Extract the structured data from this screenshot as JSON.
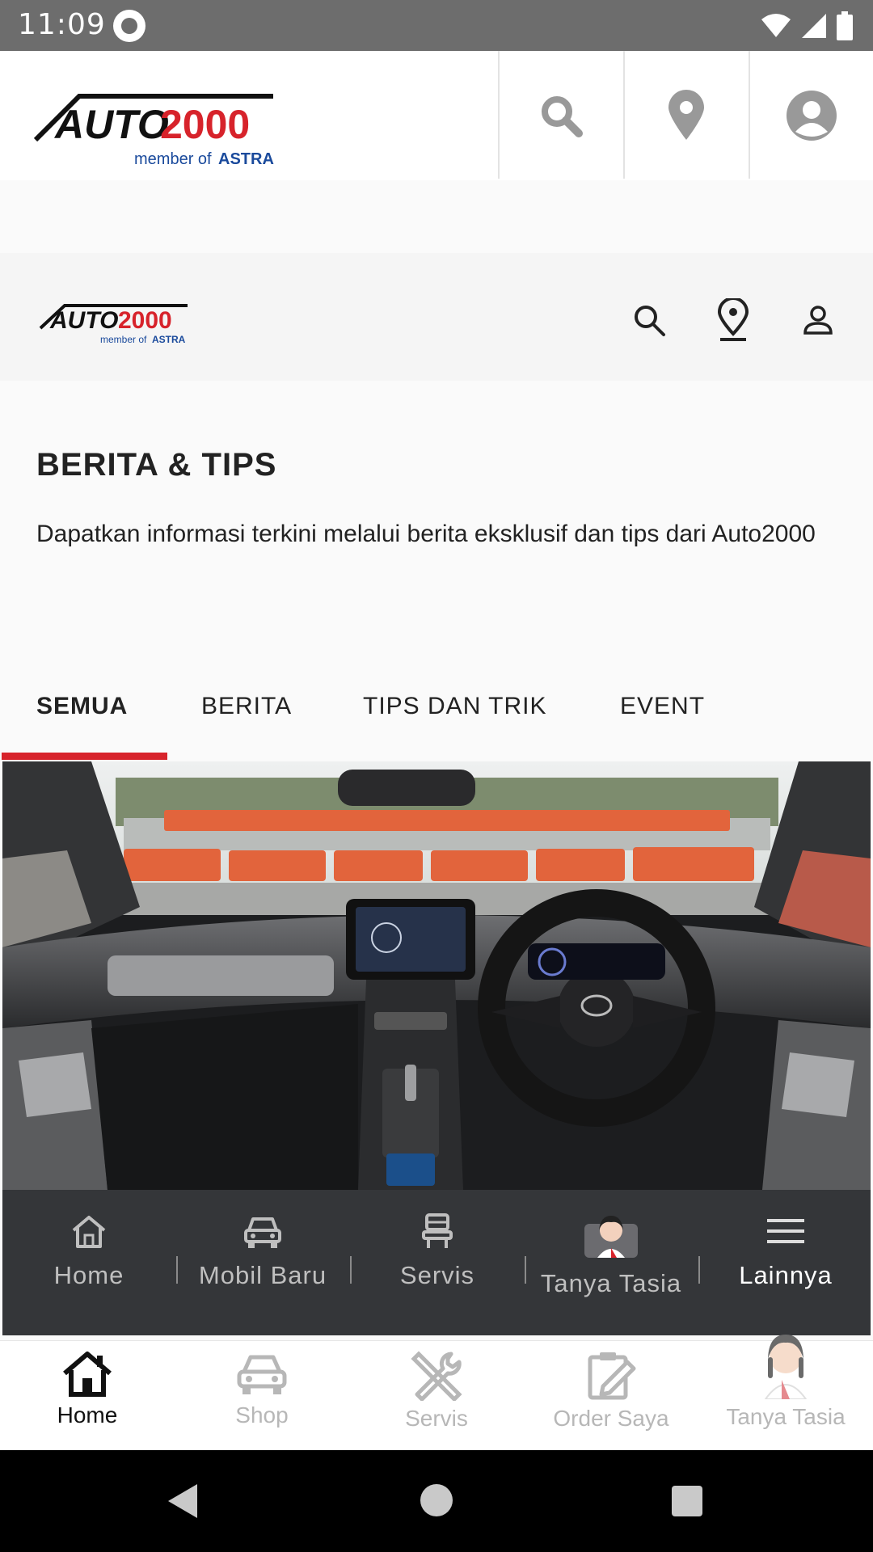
{
  "status_bar": {
    "time": "11:09"
  },
  "brand": {
    "logo_main": "AUTO 2000",
    "logo_sub": "member of ASTRA"
  },
  "header_icons": [
    "search-icon",
    "location-pin-icon",
    "account-icon"
  ],
  "page": {
    "title": "BERITA & TIPS",
    "subtitle": "Dapatkan informasi terkini melalui berita eksklusif dan tips dari Auto2000"
  },
  "tabs": [
    {
      "label": "SEMUA",
      "active": true
    },
    {
      "label": "BERITA",
      "active": false
    },
    {
      "label": "TIPS DAN TRIK",
      "active": false
    },
    {
      "label": "EVENT",
      "active": false
    }
  ],
  "web_nav": [
    {
      "label": "Home",
      "icon": "home-icon"
    },
    {
      "label": "Mobil Baru",
      "icon": "car-icon"
    },
    {
      "label": "Servis",
      "icon": "seat-icon"
    },
    {
      "label": "Tanya Tasia",
      "icon": "assistant-avatar-icon"
    },
    {
      "label": "Lainnya",
      "icon": "menu-icon"
    }
  ],
  "app_nav": [
    {
      "label": "Home",
      "icon": "home-icon",
      "active": true
    },
    {
      "label": "Shop",
      "icon": "car-icon",
      "active": false
    },
    {
      "label": "Servis",
      "icon": "tools-icon",
      "active": false
    },
    {
      "label": "Order Saya",
      "icon": "order-icon",
      "active": false
    },
    {
      "label": "Tanya Tasia",
      "icon": "assistant-avatar-icon",
      "active": false
    }
  ],
  "colors": {
    "brand_red": "#d7232b",
    "brand_blue": "#1a4a9c",
    "nav_dark": "#343639"
  }
}
